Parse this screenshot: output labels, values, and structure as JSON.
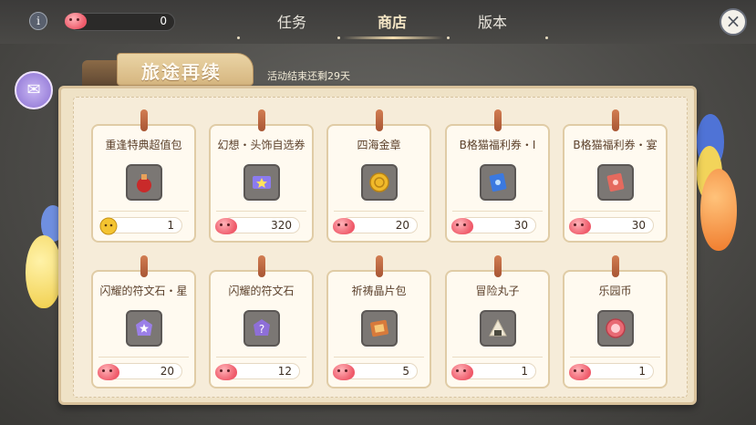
{
  "header": {
    "info_label": "i",
    "currency_value": "0",
    "close_label": "×",
    "tabs": [
      {
        "label": "任务",
        "active": false
      },
      {
        "label": "商店",
        "active": true
      },
      {
        "label": "版本",
        "active": false
      }
    ]
  },
  "event": {
    "title": "旅途再续",
    "time_left": "活动结束还剩29天"
  },
  "colors": {
    "accent": "#f4deb0",
    "panel": "#efe2c6",
    "card_text": "#5a3f2a"
  },
  "items": [
    {
      "name": "重逢特典超值包",
      "price": "1",
      "currency_icon": "gold-cat-coin-icon",
      "icon": "red-pouch-icon"
    },
    {
      "name": "幻想・头饰自选券",
      "price": "320",
      "currency_icon": "poring-icon",
      "icon": "star-ticket-icon"
    },
    {
      "name": "四海金章",
      "price": "20",
      "currency_icon": "poring-icon",
      "icon": "gold-medal-icon"
    },
    {
      "name": "B格猫福利券・I",
      "price": "30",
      "currency_icon": "poring-icon",
      "icon": "blue-ticket-icon"
    },
    {
      "name": "B格猫福利券・宴",
      "price": "30",
      "currency_icon": "poring-icon",
      "icon": "red-ticket-icon"
    },
    {
      "name": "闪耀的符文石・星",
      "price": "20",
      "currency_icon": "poring-icon",
      "icon": "star-rune-icon"
    },
    {
      "name": "闪耀的符文石",
      "price": "12",
      "currency_icon": "poring-icon",
      "icon": "question-rune-icon"
    },
    {
      "name": "祈祷晶片包",
      "price": "5",
      "currency_icon": "poring-icon",
      "icon": "chip-pack-icon"
    },
    {
      "name": "冒险丸子",
      "price": "1",
      "currency_icon": "poring-icon",
      "icon": "rice-ball-icon"
    },
    {
      "name": "乐园币",
      "price": "1",
      "currency_icon": "poring-icon",
      "icon": "park-coin-icon"
    }
  ]
}
